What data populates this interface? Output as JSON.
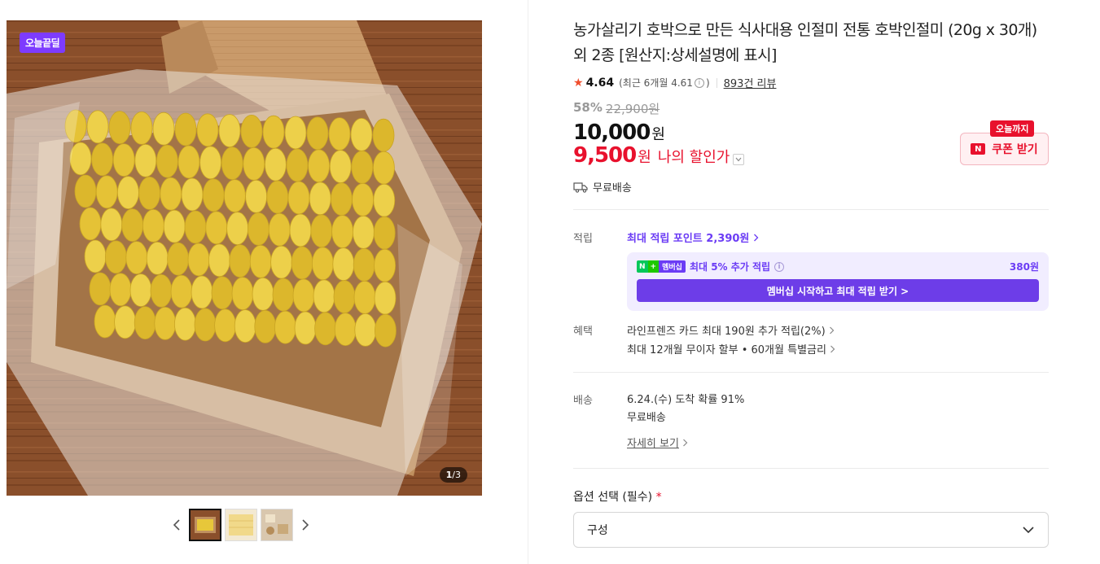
{
  "gallery": {
    "badge": "오늘끝딜",
    "counter_current": "1",
    "counter_total": "/3"
  },
  "product": {
    "title": "농가살리기 호박으로 만든 식사대용 인절미 전통 호박인절미 (20g x 30개) 외 2종 [원산지:상세설명에 표시]",
    "rating": "4.64",
    "recent_rating_text": "(최근 6개월 4.61",
    "recent_rating_close": ")",
    "review_count": "893건 리뷰",
    "discount_pct": "58%",
    "original_price": "22,900원",
    "price": "10,000",
    "price_unit": "원",
    "my_price": "9,500",
    "my_price_unit": "원",
    "my_price_label": "나의 할인가"
  },
  "coupon": {
    "tag": "오늘까지",
    "label": "쿠폰 받기",
    "logo": "N"
  },
  "shipping_summary": "무료배송",
  "points": {
    "label": "적립",
    "title": "최대 적립 포인트 2,390원",
    "member_text": "최대 5% 추가 적립",
    "member_amount": "380원",
    "member_badge_n": "N",
    "member_badge_plus": "+",
    "member_badge_text": "멤버십",
    "member_button": "멤버십 시작하고 최대 적립 받기 >"
  },
  "benefits": {
    "label": "혜택",
    "line1": "라인프렌즈 카드 최대 190원 추가 적립(2%)",
    "line2": "최대 12개월 무이자 할부 • 60개월 특별금리"
  },
  "delivery": {
    "label": "배송",
    "arrival": "6.24.(수) 도착 확률 91%",
    "fee": "무료배송",
    "detail_link": "자세히 보기"
  },
  "options": {
    "label": "옵션 선택 (필수)",
    "required_mark": "*",
    "select_value": "구성"
  },
  "colors": {
    "accent_red": "#e8112d",
    "accent_purple": "#6b3cf5",
    "star": "#f04e2d"
  }
}
